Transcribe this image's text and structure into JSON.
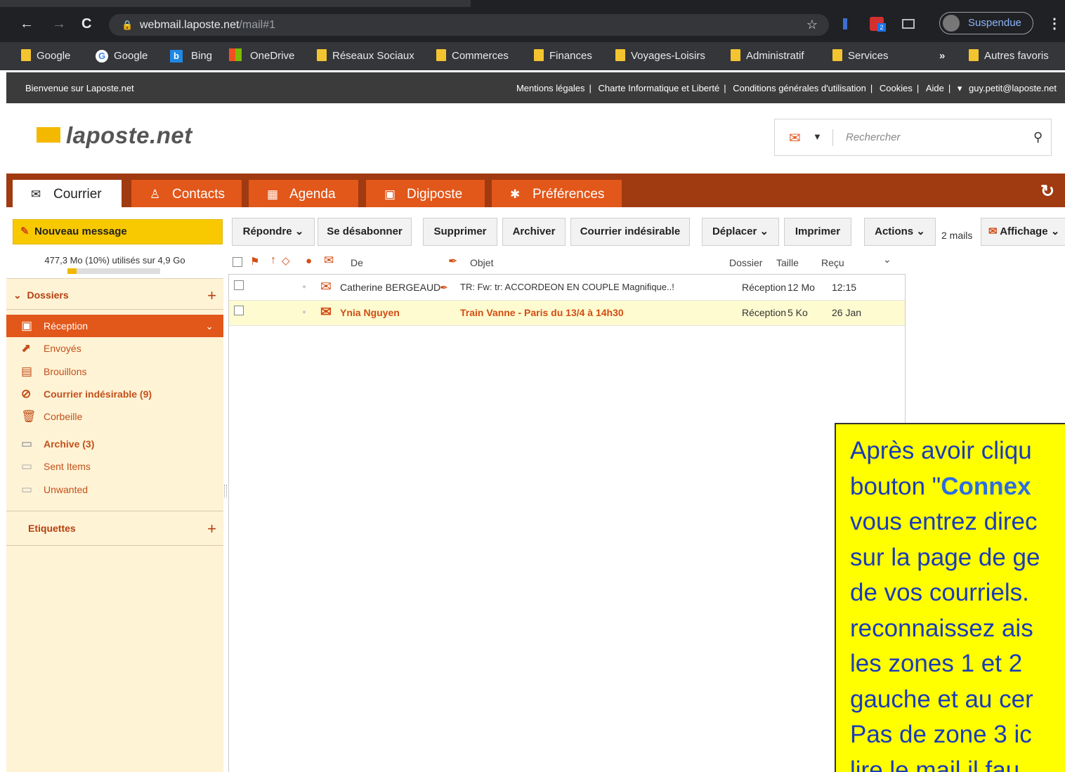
{
  "browser": {
    "url_host": "webmail.laposte.net",
    "url_path": "/mail#1",
    "profile_label": "Suspendue",
    "bookmarks": [
      "Google",
      "Google",
      "Bing",
      "OneDrive",
      "Réseaux Sociaux",
      "Commerces",
      "Finances",
      "Voyages-Loisirs",
      "Administratif",
      "Services"
    ],
    "more_label": "»",
    "other_bookmarks": "Autres favoris",
    "ext_badge": "2"
  },
  "site": {
    "welcome": "Bienvenue sur Laposte.net",
    "links": [
      "Mentions légales",
      "Charte Informatique et Liberté",
      "Conditions générales d'utilisation",
      "Cookies",
      "Aide"
    ],
    "user": "guy.petit@laposte.net",
    "logo": "laposte.net",
    "search_placeholder": "Rechercher"
  },
  "tabs": [
    "Courrier",
    "Contacts",
    "Agenda",
    "Digiposte",
    "Préférences"
  ],
  "toolbar": {
    "new_message": "Nouveau message",
    "reply": "Répondre",
    "unsubscribe": "Se désabonner",
    "delete": "Supprimer",
    "archive": "Archiver",
    "junk": "Courrier indésirable",
    "move": "Déplacer",
    "print": "Imprimer",
    "actions": "Actions",
    "count": "2 mails",
    "display": "Affichage"
  },
  "sidebar": {
    "quota": "477,3 Mo (10%) utilisés sur 4,9 Go",
    "quota_percent": 10,
    "folders_title": "Dossiers",
    "folders": [
      "Réception",
      "Envoyés",
      "Brouillons",
      "Courrier indésirable (9)",
      "Corbeille",
      "Archive (3)",
      "Sent Items",
      "Unwanted"
    ],
    "labels_title": "Etiquettes"
  },
  "list": {
    "headers": {
      "from": "De",
      "subject": "Objet",
      "folder": "Dossier",
      "size": "Taille",
      "received": "Reçu"
    },
    "rows": [
      {
        "from": "Catherine BERGEAUD",
        "subject": "TR: Fw: tr: ACCORDEON EN COUPLE Magnifique..!",
        "folder": "Réception",
        "size": "12 Mo",
        "received": "12:15"
      },
      {
        "from": "Ynia Nguyen",
        "subject": "Train Vanne - Paris du 13/4 à 14h30",
        "folder": "Réception",
        "size": "5 Ko",
        "received": "26 Jan"
      }
    ]
  },
  "note": {
    "lines": [
      "Après avoir cliqu",
      "bouton \"",
      "vous entrez direc",
      "sur la page de ge",
      "de vos courriels.",
      "reconnaissez ais",
      "les zones 1 et 2",
      "gauche et au cer",
      "Pas de zone 3 ic",
      "lire le mail il fau"
    ],
    "highlight": "Connex"
  },
  "colors": {
    "tab_bar": "#a03a10",
    "tab": "#e2571a",
    "accent": "#f8c900",
    "note_bg": "#ffff00"
  }
}
